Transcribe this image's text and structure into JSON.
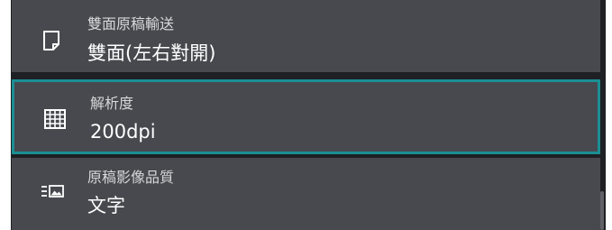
{
  "settings": [
    {
      "icon": "document-page-icon",
      "title": "雙面原稿輸送",
      "value": "雙面(左右對開)",
      "selected": false
    },
    {
      "icon": "grid-icon",
      "title": "解析度",
      "value": "200dpi",
      "selected": true
    },
    {
      "icon": "text-image-icon",
      "title": "原稿影像品質",
      "value": "文字",
      "selected": false
    }
  ],
  "colors": {
    "panel_bg": "#1e2023",
    "row_bg": "#47494e",
    "selected_border": "#1a8f94",
    "title_text": "#d6d7d9",
    "value_text": "#ffffff"
  }
}
